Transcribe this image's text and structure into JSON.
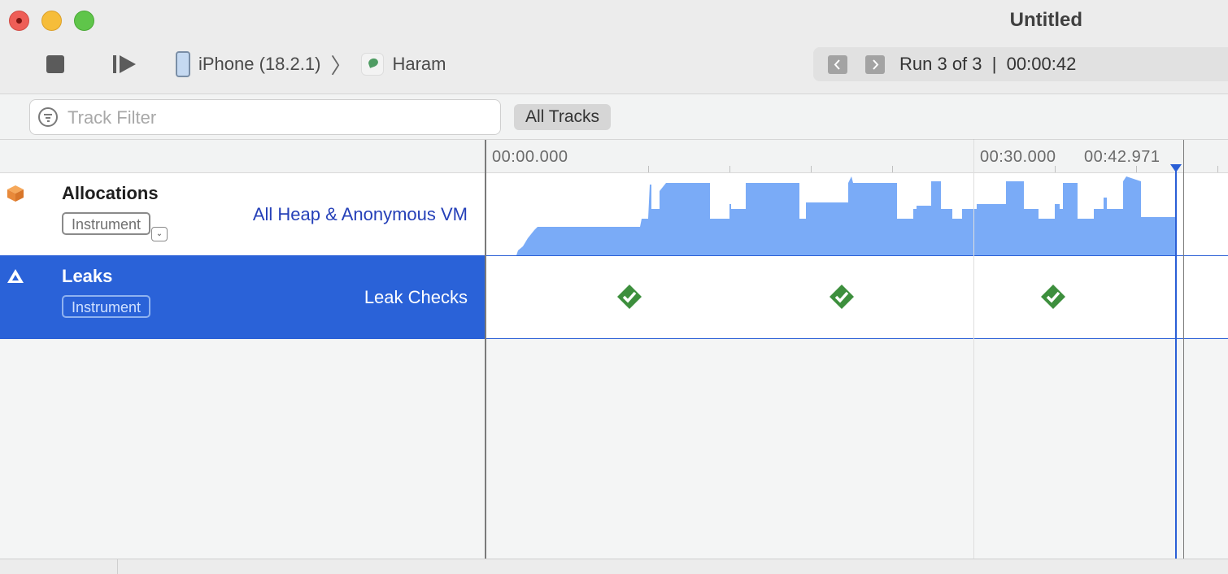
{
  "window": {
    "title": "Untitled"
  },
  "toolbar": {
    "device": "iPhone (18.2.1)",
    "app": "Haram",
    "run_status": "Run 3 of 3  |  00:00:42"
  },
  "filter": {
    "placeholder": "Track Filter",
    "scope_button": "All Tracks"
  },
  "ruler": {
    "start": "00:00.000",
    "mark_30": "00:30.000",
    "current": "00:42.971"
  },
  "tracks": [
    {
      "name": "Allocations",
      "type_badge": "Instrument",
      "detail": "All Heap & Anonymous VM",
      "icon": "allocations-box-icon",
      "color": "#7aabf7"
    },
    {
      "name": "Leaks",
      "type_badge": "Instrument",
      "detail": "Leak Checks",
      "icon": "leaks-triangle-icon",
      "selected": true,
      "check_count": 3
    }
  ],
  "colors": {
    "selection": "#2a62d8",
    "allocation_fill": "#7aabf7",
    "leak_check": "#3d8f3d",
    "playhead": "#2a5fd6"
  }
}
